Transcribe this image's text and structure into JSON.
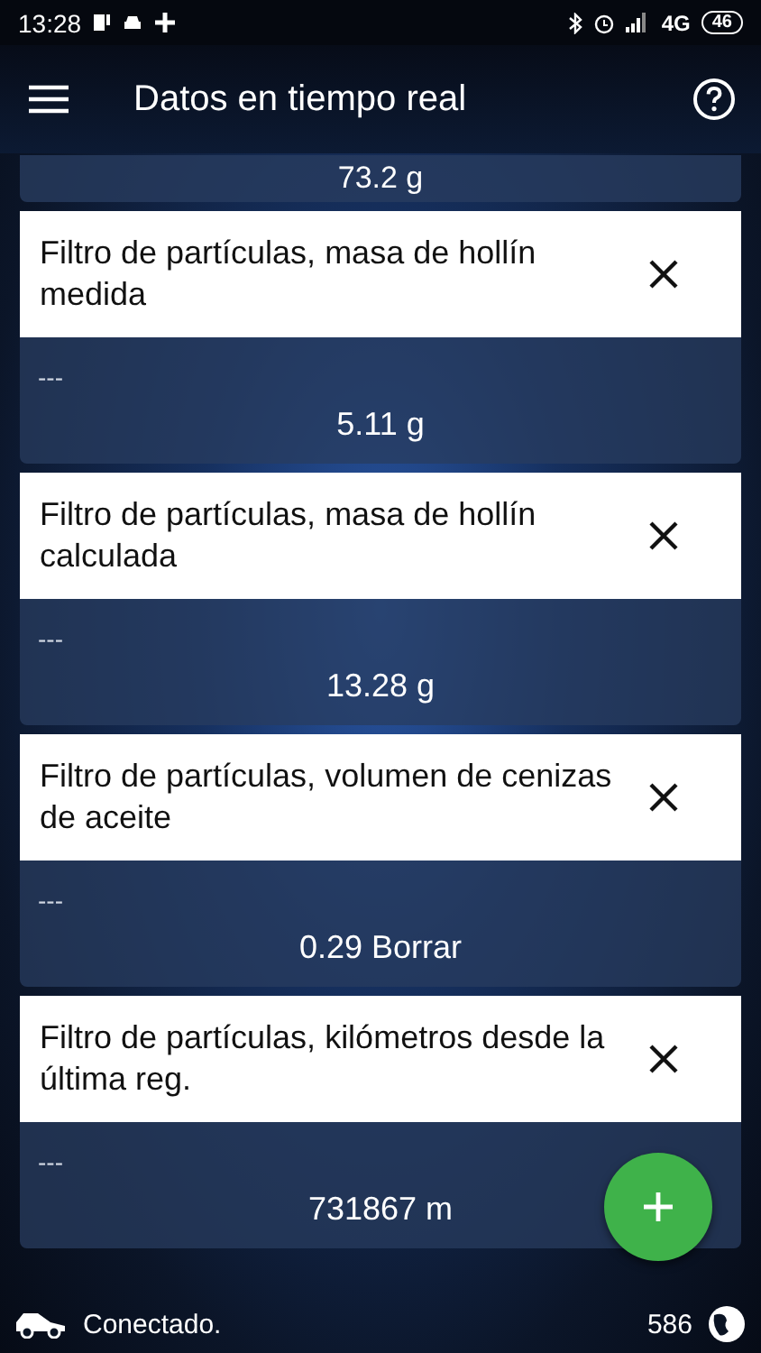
{
  "status_bar": {
    "time": "13:28",
    "network": "4G",
    "battery": "46"
  },
  "app_bar": {
    "title": "Datos en tiempo real"
  },
  "partial_value": "73.2 g",
  "cards": [
    {
      "title": "Filtro de partículas, masa de hollín medida",
      "sub": "---",
      "value": "5.11 g"
    },
    {
      "title": "Filtro de partículas, masa de hollín calculada",
      "sub": "---",
      "value": "13.28 g"
    },
    {
      "title": "Filtro de partículas, volumen de cenizas de aceite",
      "sub": "---",
      "value": "0.29 Borrar"
    },
    {
      "title": "Filtro de partículas, kilómetros desde la última reg.",
      "sub": "---",
      "value": "731867 m"
    }
  ],
  "footer": {
    "status": "Conectado.",
    "count": "586"
  }
}
